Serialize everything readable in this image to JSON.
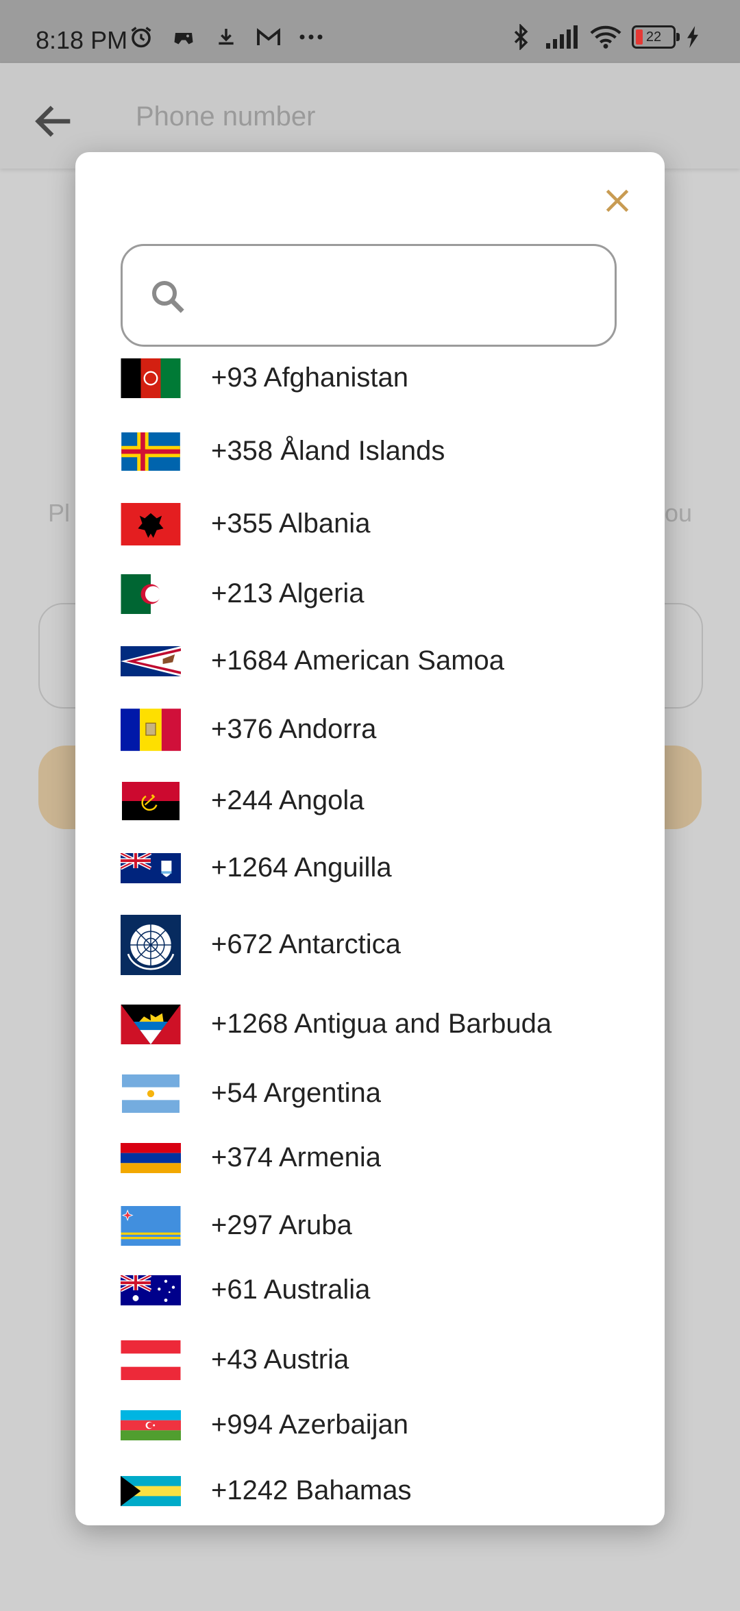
{
  "status_bar": {
    "time": "8:18 PM",
    "battery_level": "22",
    "left_icons": [
      "alarm-icon",
      "game-icon",
      "download-icon",
      "gmail-icon",
      "more-dots-icon"
    ],
    "right_icons": [
      "bluetooth-icon",
      "signal-icon",
      "wifi-icon",
      "battery-icon",
      "charging-icon"
    ]
  },
  "app_bar": {
    "title": "Phone number",
    "back_icon": "arrow-left-icon"
  },
  "background": {
    "text_left": "Pl",
    "text_right": "ou"
  },
  "dialog": {
    "close_icon": "close-icon",
    "close_color": "#c89b52",
    "search": {
      "placeholder": "",
      "value": "",
      "icon": "search-icon"
    },
    "countries": [
      {
        "label": "+93 Afghanistan",
        "flag": "afghanistan-flag"
      },
      {
        "label": "+358 Åland Islands",
        "flag": "aland-islands-flag"
      },
      {
        "label": "+355 Albania",
        "flag": "albania-flag"
      },
      {
        "label": "+213 Algeria",
        "flag": "algeria-flag"
      },
      {
        "label": "+1684 American Samoa",
        "flag": "american-samoa-flag"
      },
      {
        "label": "+376 Andorra",
        "flag": "andorra-flag"
      },
      {
        "label": "+244 Angola",
        "flag": "angola-flag"
      },
      {
        "label": "+1264 Anguilla",
        "flag": "anguilla-flag"
      },
      {
        "label": "+672 Antarctica",
        "flag": "antarctica-flag"
      },
      {
        "label": "+1268 Antigua and Barbuda",
        "flag": "antigua-and-barbuda-flag"
      },
      {
        "label": "+54 Argentina",
        "flag": "argentina-flag"
      },
      {
        "label": "+374 Armenia",
        "flag": "armenia-flag"
      },
      {
        "label": "+297 Aruba",
        "flag": "aruba-flag"
      },
      {
        "label": "+61 Australia",
        "flag": "australia-flag"
      },
      {
        "label": "+43 Austria",
        "flag": "austria-flag"
      },
      {
        "label": "+994 Azerbaijan",
        "flag": "azerbaijan-flag"
      },
      {
        "label": "+1242 Bahamas",
        "flag": "bahamas-flag"
      }
    ]
  }
}
